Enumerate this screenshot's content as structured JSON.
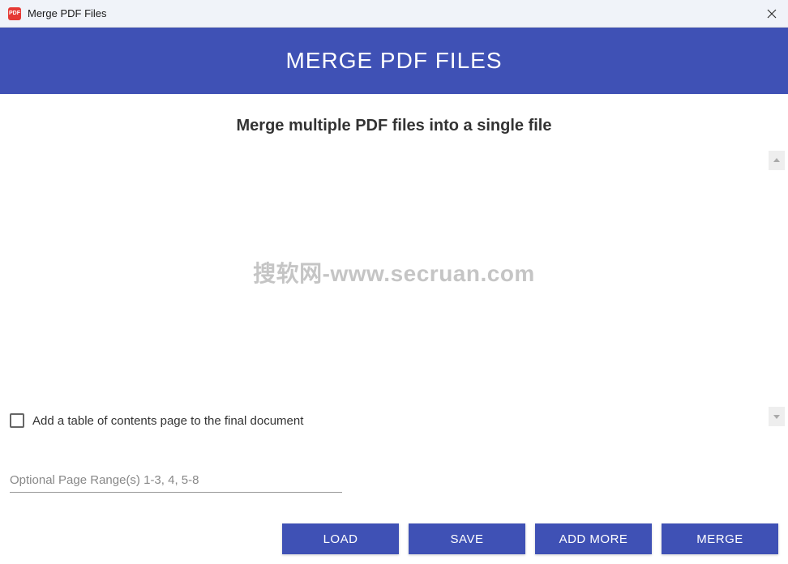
{
  "window": {
    "title": "Merge PDF Files",
    "icon_label": "PDF"
  },
  "header": {
    "title": "MERGE PDF FILES"
  },
  "main": {
    "subtitle": "Merge multiple PDF files into a single file",
    "watermark": "搜软网-www.secruan.com"
  },
  "options": {
    "toc_checkbox_label": "Add a table of contents page to the final document",
    "page_range_placeholder": "Optional Page Range(s) 1-3, 4, 5-8"
  },
  "buttons": {
    "load": "LOAD",
    "save": "SAVE",
    "add_more": "ADD MORE",
    "merge": "MERGE"
  }
}
